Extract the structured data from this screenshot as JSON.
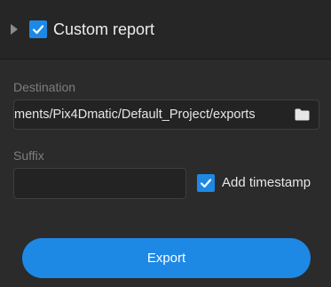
{
  "section": {
    "title": "Custom report",
    "enabled": true
  },
  "destination": {
    "label": "Destination",
    "value": "ments/Pix4Dmatic/Default_Project/exports"
  },
  "suffix": {
    "label": "Suffix",
    "value": "",
    "placeholder": ""
  },
  "timestamp": {
    "label": "Add timestamp",
    "checked": true
  },
  "export": {
    "label": "Export"
  },
  "colors": {
    "accent": "#1e88e5",
    "background": "#2b2b2b",
    "header_background": "#262626"
  }
}
